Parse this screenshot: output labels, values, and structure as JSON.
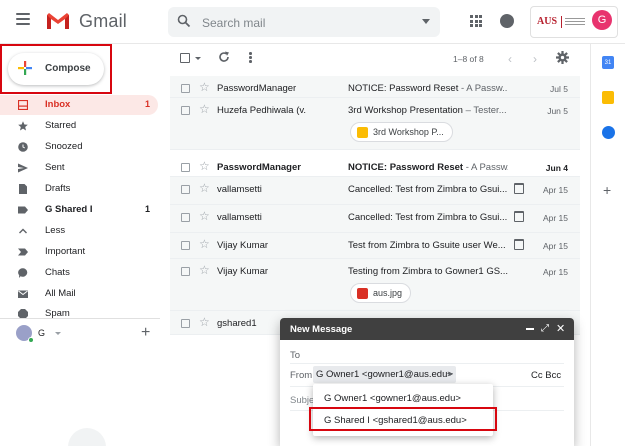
{
  "header": {
    "app_name": "Gmail",
    "search_placeholder": "Search mail",
    "org_logo_text": "AUS",
    "avatar_letter": "G",
    "avatar_color": "#e8336e"
  },
  "compose": {
    "label": "Compose"
  },
  "sidebar": {
    "items": [
      {
        "label": "Inbox",
        "count": "1",
        "icon": "inbox-icon",
        "active": true
      },
      {
        "label": "Starred",
        "count": "",
        "icon": "star-icon"
      },
      {
        "label": "Snoozed",
        "count": "",
        "icon": "clock-icon"
      },
      {
        "label": "Sent",
        "count": "",
        "icon": "send-icon"
      },
      {
        "label": "Drafts",
        "count": "",
        "icon": "draft-icon"
      },
      {
        "label": "G Shared I",
        "count": "1",
        "icon": "label-icon",
        "bold": true
      },
      {
        "label": "Less",
        "count": "",
        "icon": "chevron-up-icon"
      },
      {
        "label": "Important",
        "count": "",
        "icon": "important-icon"
      },
      {
        "label": "Chats",
        "count": "",
        "icon": "chat-icon"
      },
      {
        "label": "All Mail",
        "count": "",
        "icon": "mail-icon"
      },
      {
        "label": "Spam",
        "count": "",
        "icon": "spam-icon"
      }
    ],
    "hangouts_user": "G"
  },
  "toolbar": {
    "range": "1–8 of 8"
  },
  "emails": [
    {
      "sender": "PasswordManager",
      "subject": "NOTICE: Password Reset",
      "snippet": " - A Passw...",
      "date": "Jul 5",
      "unread": false
    },
    {
      "sender": "Huzefa Pedhiwala (v.",
      "subject": "3rd Workshop Presentation",
      "snippet": " – Tester...",
      "date": "Jun 5",
      "unread": false,
      "attachment": "3rd Workshop P...",
      "attachment_type": "slides"
    },
    {
      "sender": "PasswordManager",
      "subject": "NOTICE: Password Reset",
      "snippet": " - A Passw...",
      "date": "Jun 4",
      "unread": true
    },
    {
      "sender": "vallamsetti",
      "subject": "Cancelled: Test from Zimbra to Gsui...",
      "snippet": "",
      "date": "Apr 15",
      "unread": false,
      "calendar": true
    },
    {
      "sender": "vallamsetti",
      "subject": "Cancelled: Test from Zimbra to Gsui...",
      "snippet": "",
      "date": "Apr 15",
      "unread": false,
      "calendar": true
    },
    {
      "sender": "Vijay Kumar",
      "subject": "Test from Zimbra to Gsuite user We...",
      "snippet": "",
      "date": "Apr 15",
      "unread": false,
      "calendar": true
    },
    {
      "sender": "Vijay Kumar",
      "subject": "Testing from Zimbra to Gowner1 GS...",
      "snippet": "",
      "date": "Apr 15",
      "unread": false,
      "attachment": "aus.jpg",
      "attachment_type": "image"
    },
    {
      "sender": "gshared1",
      "subject": "",
      "snippet": "",
      "date": "",
      "unread": false
    }
  ],
  "compose_window": {
    "title": "New Message",
    "to_label": "To",
    "from_label": "From",
    "from_value": "G Owner1 <gowner1@aus.edu>",
    "cc_bcc": "Cc Bcc",
    "subject_placeholder": "Subje"
  },
  "from_dropdown": {
    "options": [
      "G Owner1 <gowner1@aus.edu>",
      "G Shared I <gshared1@aus.edu>"
    ],
    "highlighted_index": 1
  },
  "colors": {
    "accent_red": "#d93025",
    "highlight_box": "#d7060f",
    "compose_header": "#404040"
  }
}
